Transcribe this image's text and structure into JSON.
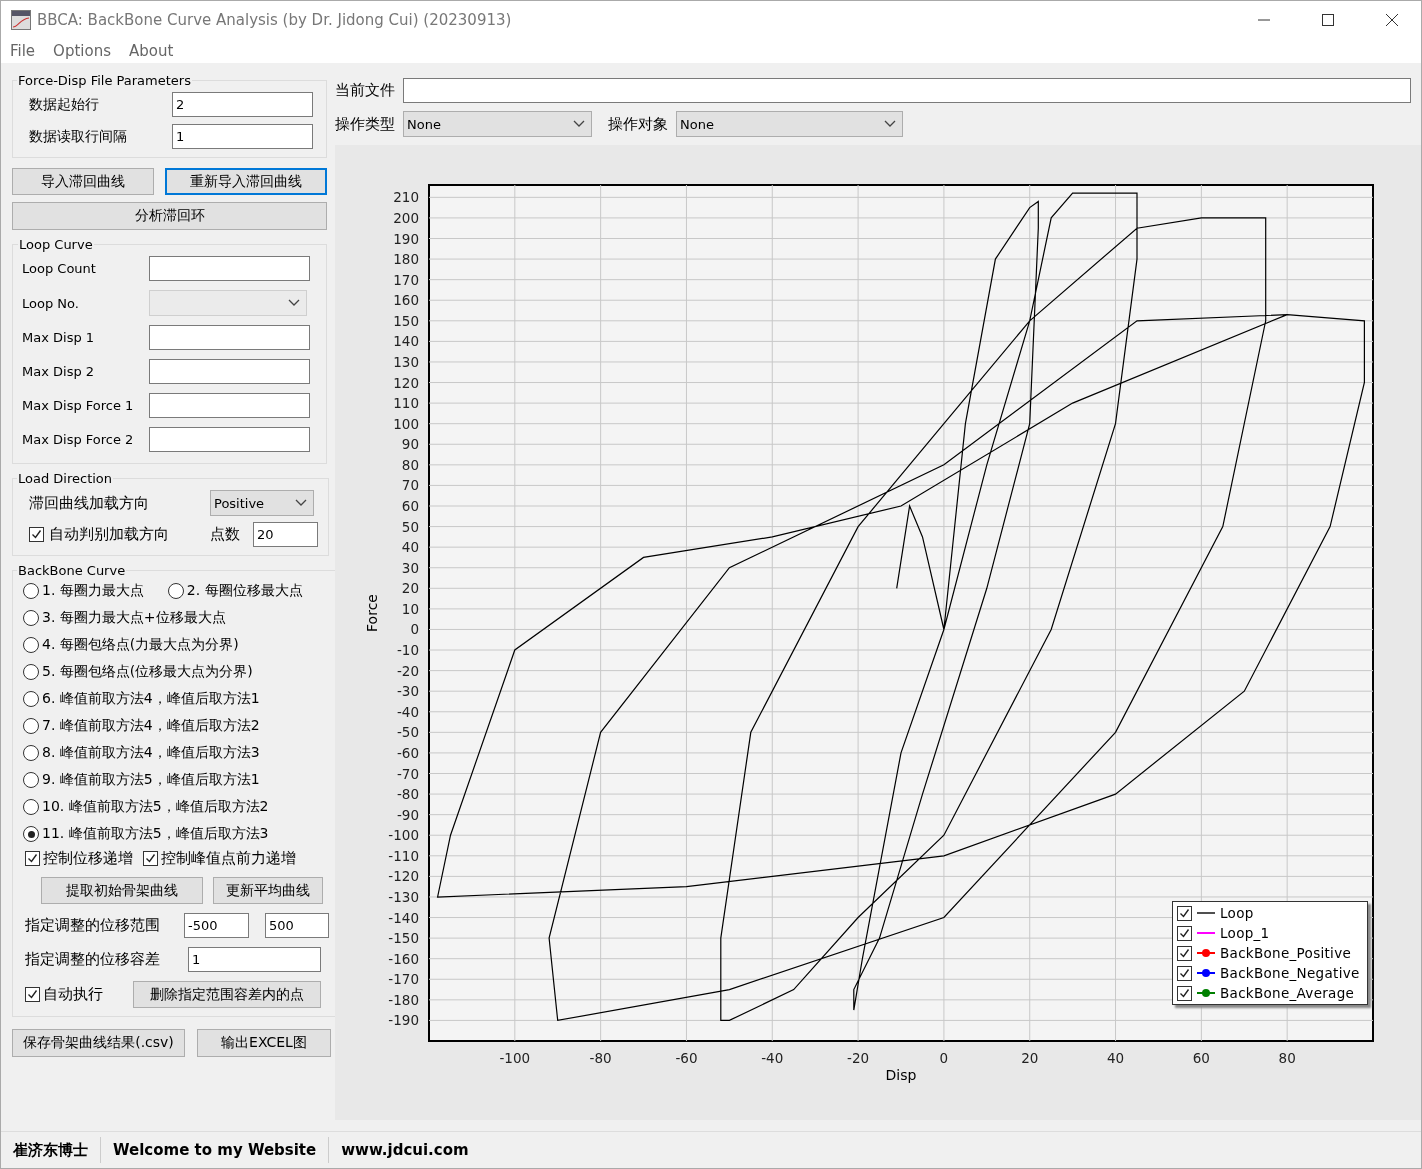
{
  "window": {
    "title": "BBCA: BackBone Curve Analysis (by Dr. Jidong Cui) (20230913)"
  },
  "menu": [
    "File",
    "Options",
    "About"
  ],
  "file_params": {
    "title": "Force-Disp File Parameters",
    "fields": [
      {
        "label": "数据起始行",
        "value": "2"
      },
      {
        "label": "数据读取行间隔",
        "value": "1"
      }
    ]
  },
  "import_buttons": [
    {
      "label": "导入滞回曲线",
      "focused": false
    },
    {
      "label": "重新导入滞回曲线",
      "focused": true
    }
  ],
  "analyze_button": "分析滞回环",
  "loop_curve": {
    "title": "Loop Curve",
    "fields": [
      {
        "label": "Loop Count",
        "kind": "text",
        "disabled": false
      },
      {
        "label": "Loop No.",
        "kind": "select",
        "disabled": true
      },
      {
        "label": "Max Disp 1",
        "kind": "text",
        "disabled": false
      },
      {
        "label": "Max Disp 2",
        "kind": "text",
        "disabled": false
      },
      {
        "label": "Max Disp Force 1",
        "kind": "text",
        "disabled": false
      },
      {
        "label": "Max Disp Force 2",
        "kind": "text",
        "disabled": false
      }
    ]
  },
  "load_direction": {
    "title": "Load Direction",
    "direction_label": "滞回曲线加载方向",
    "direction_value": "Positive",
    "auto": {
      "label": "自动判别加载方向",
      "checked": true
    },
    "points_label": "点数",
    "points_value": "20"
  },
  "backbone": {
    "title": "BackBone Curve",
    "methods": [
      {
        "label": "1. 每圈力最大点",
        "selected": false
      },
      {
        "label": "2. 每圈位移最大点",
        "selected": false
      },
      {
        "label": "3. 每圈力最大点+位移最大点",
        "selected": false
      },
      {
        "label": "4. 每圈包络点(力最大点为分界)",
        "selected": false
      },
      {
        "label": "5. 每圈包络点(位移最大点为分界)",
        "selected": false
      },
      {
        "label": "6. 峰值前取方法4，峰值后取方法1",
        "selected": false
      },
      {
        "label": "7. 峰值前取方法4，峰值后取方法2",
        "selected": false
      },
      {
        "label": "8. 峰值前取方法4，峰值后取方法3",
        "selected": false
      },
      {
        "label": "9. 峰值前取方法5，峰值后取方法1",
        "selected": false
      },
      {
        "label": "10. 峰值前取方法5，峰值后取方法2",
        "selected": false
      },
      {
        "label": "11. 峰值前取方法5，峰值后取方法3",
        "selected": true
      }
    ],
    "options": [
      {
        "label": "控制位移递增",
        "checked": true
      },
      {
        "label": "控制峰值点前力递增",
        "checked": true
      }
    ],
    "extract_button": "提取初始骨架曲线",
    "update_button": "更新平均曲线",
    "range_label": "指定调整的位移范围",
    "range_min": "-500",
    "range_max": "500",
    "tolerance_label": "指定调整的位移容差",
    "tolerance_value": "1",
    "auto_run": {
      "label": "自动执行",
      "checked": true
    },
    "delete_button": "删除指定范围容差内的点"
  },
  "save_buttons": [
    "保存骨架曲线结果(.csv)",
    "输出EXCEL图"
  ],
  "current_file": {
    "label": "当前文件"
  },
  "operation_type": {
    "label": "操作类型",
    "value": "None"
  },
  "operation_target": {
    "label": "操作对象",
    "value": "None"
  },
  "chart": {
    "chart_data": {
      "type": "line",
      "grid": true,
      "xlabel": "Disp",
      "ylabel": "Force",
      "xlim": [
        -120,
        100
      ],
      "ylim": [
        -200,
        216
      ],
      "xticks": [
        -100,
        -80,
        -60,
        -40,
        -20,
        0,
        20,
        40,
        60,
        80
      ],
      "yticks": [
        210,
        200,
        190,
        180,
        170,
        160,
        150,
        140,
        130,
        120,
        110,
        100,
        90,
        80,
        70,
        60,
        50,
        40,
        30,
        20,
        10,
        0,
        -10,
        -20,
        -30,
        -40,
        -50,
        -60,
        -70,
        -80,
        -90,
        -100,
        -110,
        -120,
        -130,
        -140,
        -150,
        -160,
        -170,
        -180,
        -190
      ],
      "x": [
        -11,
        -8,
        -5,
        0,
        5,
        12,
        20,
        22,
        22,
        20,
        10,
        -5,
        -15,
        -21,
        -21,
        -19,
        -10,
        0,
        10,
        20,
        25,
        30,
        45,
        45,
        40,
        25,
        0,
        -20,
        -35,
        -50,
        -52,
        -52,
        -45,
        -20,
        0,
        20,
        45,
        60,
        75,
        75,
        65,
        40,
        0,
        -50,
        -90,
        -92,
        -80,
        -50,
        0,
        45,
        80,
        98,
        98,
        90,
        70,
        40,
        0,
        -60,
        -118,
        -115,
        -100,
        -70,
        -40,
        -10,
        30,
        80
      ],
      "series": [
        {
          "name": "Loop",
          "color": "#000000",
          "values": [
            20,
            60,
            45,
            0,
            100,
            180,
            205,
            208,
            195,
            100,
            20,
            -80,
            -150,
            -175,
            -185,
            -160,
            -60,
            0,
            80,
            150,
            200,
            212,
            212,
            180,
            100,
            0,
            -100,
            -140,
            -175,
            -190,
            -190,
            -150,
            -50,
            50,
            100,
            150,
            195,
            200,
            200,
            150,
            50,
            -50,
            -140,
            -175,
            -190,
            -150,
            -50,
            30,
            80,
            150,
            153,
            150,
            120,
            50,
            -30,
            -80,
            -110,
            -125,
            -130,
            -100,
            -10,
            35,
            45,
            60,
            110,
            153
          ]
        }
      ]
    },
    "legend": [
      {
        "checked": true,
        "kind": "line",
        "color": "#505050"
      },
      {
        "label": "Loop_1",
        "checked": true,
        "kind": "line",
        "color": "#ff00ff"
      },
      {
        "label": "BackBone_Positive",
        "checked": true,
        "kind": "marker",
        "color": "#ff0000"
      },
      {
        "label": "BackBone_Negative",
        "checked": true,
        "kind": "marker",
        "color": "#0000ff"
      },
      {
        "label": "BackBone_Average",
        "checked": true,
        "kind": "marker",
        "color": "#008000"
      }
    ]
  },
  "status_bar": [
    "崔济东博士",
    "Welcome to my Website",
    "www.jdcui.com"
  ]
}
